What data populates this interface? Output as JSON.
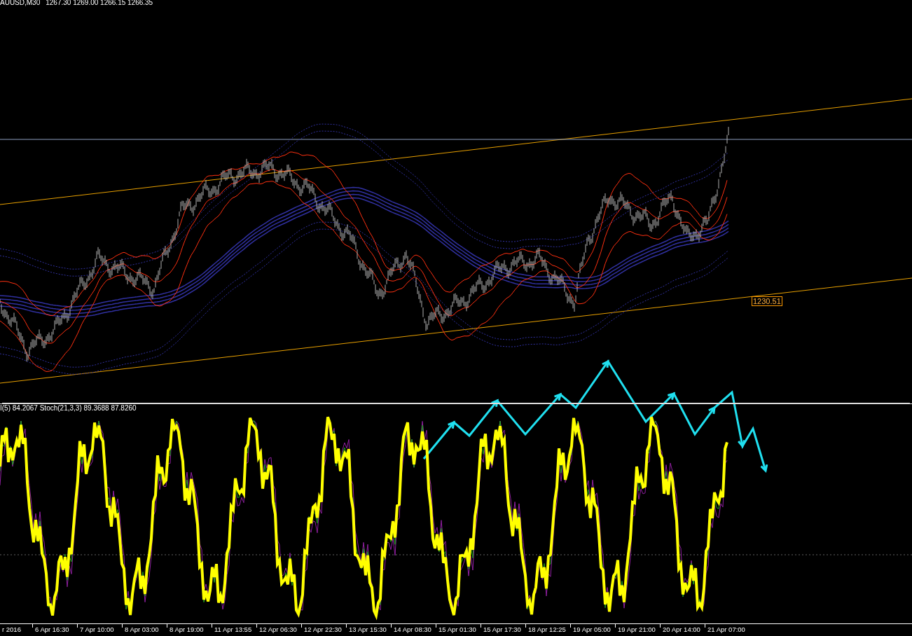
{
  "price_chart": {
    "symbol": "AUUSD,M30",
    "prices": "1267.30 1269.00 1266.15 1266.35",
    "price_label": "1230.51"
  },
  "indicator": {
    "label": "I(5) 84.2067  Stoch(21,3,3) 89.3688 87.8260"
  },
  "time_axis": {
    "labels": [
      "r 2016",
      "6 Apr 16:30",
      "7 Apr 10:00",
      "8 Apr 03:00",
      "8 Apr 19:00",
      "11 Apr 13:55",
      "12 Apr 06:30",
      "12 Apr 22:30",
      "13 Apr 15:30",
      "14 Apr 08:30",
      "15 Apr 01:30",
      "15 Apr 17:30",
      "18 Apr 12:25",
      "19 Apr 05:00",
      "19 Apr 21:00",
      "20 Apr 14:00",
      "21 Apr 07:00"
    ]
  }
}
